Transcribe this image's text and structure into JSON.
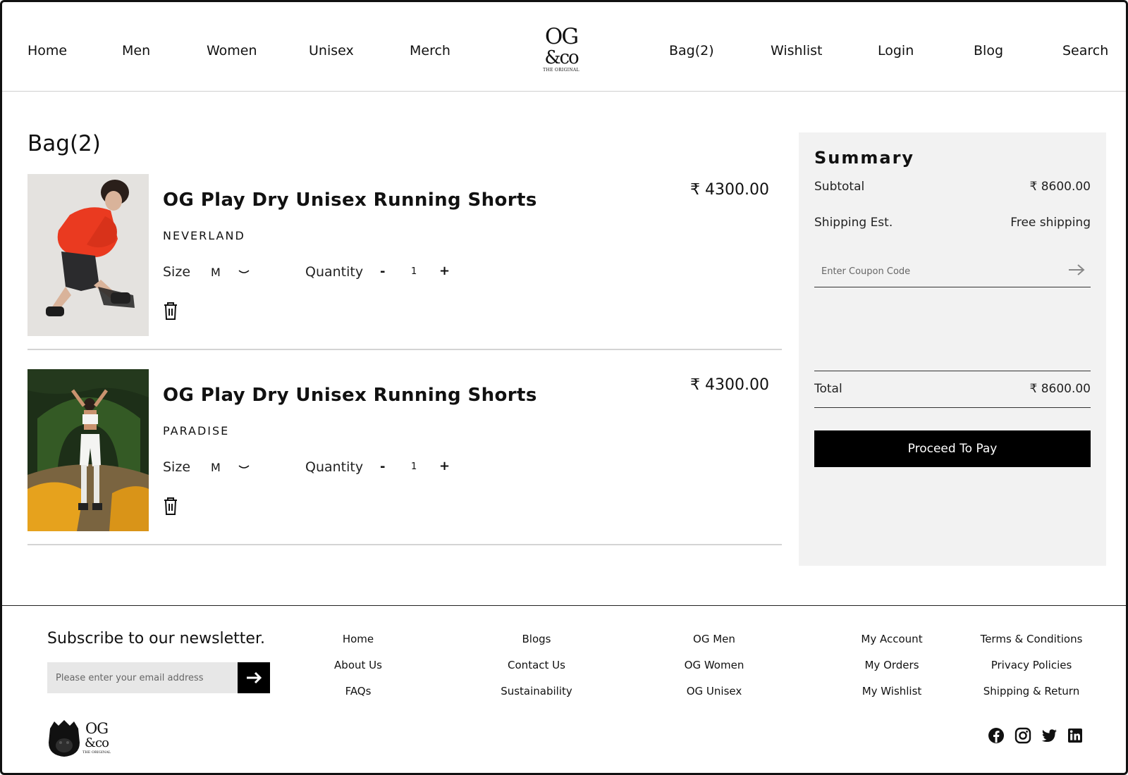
{
  "nav": {
    "left": [
      "Home",
      "Men",
      "Women",
      "Unisex",
      "Merch"
    ],
    "right": [
      "Bag(2)",
      "Wishlist",
      "Login",
      "Blog",
      "Search"
    ],
    "logo": {
      "line1": "OG",
      "line2": "&co",
      "line3": "THE ORIGINAL"
    }
  },
  "bag": {
    "title": "Bag(2)",
    "items": [
      {
        "name": "OG Play Dry Unisex Running Shorts",
        "variant": "NEVERLAND",
        "price": "₹ 4300.00",
        "size_label": "Size",
        "size": "M",
        "qty_label": "Quantity",
        "minus": "-",
        "quantity": "1",
        "plus": "+"
      },
      {
        "name": "OG Play Dry Unisex Running Shorts",
        "variant": "PARADISE",
        "price": "₹ 4300.00",
        "size_label": "Size",
        "size": "M",
        "qty_label": "Quantity",
        "minus": "-",
        "quantity": "1",
        "plus": "+"
      }
    ]
  },
  "summary": {
    "title": "Summary",
    "subtotal_label": "Subtotal",
    "subtotal": "₹ 8600.00",
    "shipping_label": "Shipping Est.",
    "shipping": "Free shipping",
    "coupon_placeholder": "Enter Coupon Code",
    "total_label": "Total",
    "total": "₹ 8600.00",
    "pay_label": "Proceed To Pay"
  },
  "footer": {
    "newsletter_title": "Subscribe to our newsletter.",
    "email_placeholder": "Please enter your email address",
    "columns": [
      [
        "Home",
        "About Us",
        "FAQs"
      ],
      [
        "Blogs",
        "Contact Us",
        "Sustainability"
      ],
      [
        "OG Men",
        "OG Women",
        "OG Unisex"
      ],
      [
        "My Account",
        "My Orders",
        "My Wishlist"
      ],
      [
        "Terms & Conditions",
        "Privacy Policies",
        "Shipping & Return"
      ]
    ],
    "logo": {
      "line1": "OG",
      "line2": "&co",
      "line3": "THE ORIGINAL"
    },
    "social_icons": [
      "facebook-icon",
      "instagram-icon",
      "twitter-icon",
      "linkedin-icon"
    ]
  },
  "colors": {
    "accent": "#000000",
    "panel": "#f2f2f2",
    "divider": "#d4d4d4"
  }
}
